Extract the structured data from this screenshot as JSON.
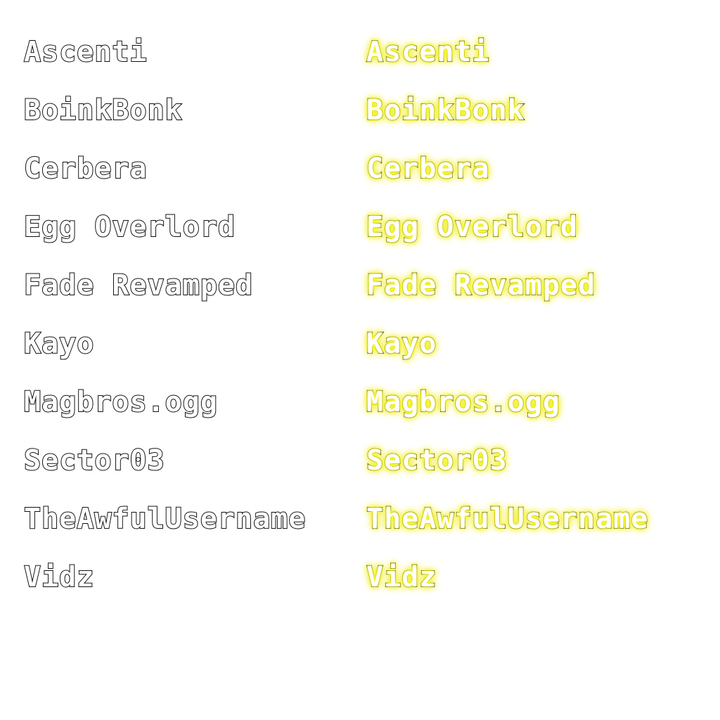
{
  "names": [
    "Ascenti",
    "BoinkBonk",
    "Cerbera",
    "Egg Overlord",
    "Fade Revamped",
    "Kayo",
    "Magbros.ogg",
    "Sector03",
    "TheAwfulUsername",
    "Vidz"
  ],
  "colors": {
    "background": "#ffffff",
    "text_fill": "#ffffff",
    "outline": "#111111",
    "glow": "#f4f000"
  }
}
